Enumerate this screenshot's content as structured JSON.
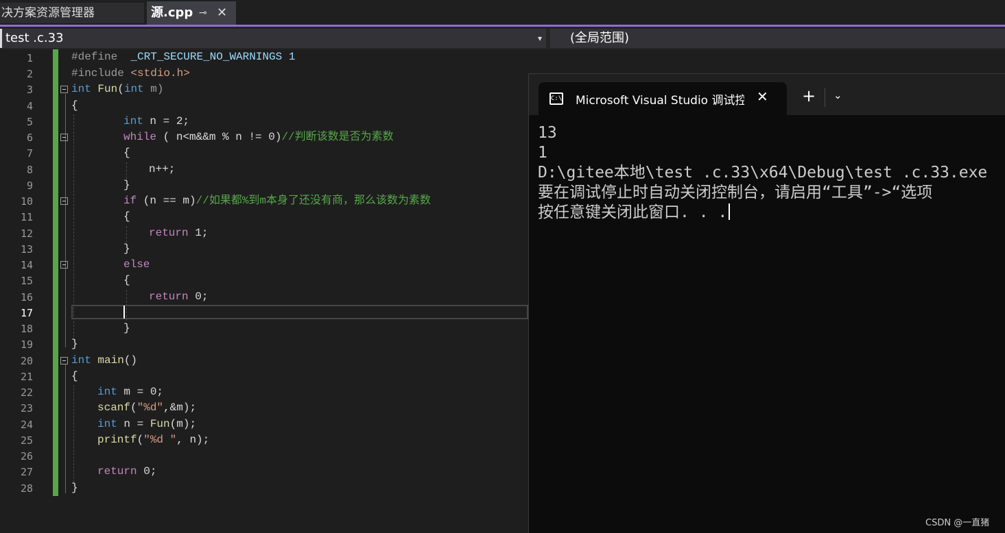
{
  "tabs": {
    "inactive_label": "决方案资源管理器",
    "active_label": "源.cpp",
    "pin_glyph": "⊸",
    "close_glyph": "✕"
  },
  "navbar": {
    "project": "test .c.33",
    "dropdown_arrow": "▾",
    "scope": "(全局范围)"
  },
  "editor": {
    "current_line": 17,
    "line_numbers": [
      "1",
      "2",
      "3",
      "4",
      "5",
      "6",
      "7",
      "8",
      "9",
      "10",
      "11",
      "12",
      "13",
      "14",
      "15",
      "16",
      "17",
      "18",
      "19",
      "20",
      "21",
      "22",
      "23",
      "24",
      "25",
      "26",
      "27",
      "28"
    ]
  },
  "console": {
    "icon_glyph": "C:\\",
    "title": "Microsoft Visual Studio 调试控制台",
    "close_glyph": "✕",
    "plus_glyph": "+",
    "chevron_glyph": "⌄",
    "output_lines": [
      "13",
      "1",
      "D:\\gitee本地\\test .c.33\\x64\\Debug\\test .c.33.exe",
      "要在调试停止时自动关闭控制台，请启用“工具”->“选项",
      "按任意键关闭此窗口. . ."
    ]
  },
  "watermark": "CSDN @一直猪",
  "colors": {
    "accent": "#8b6fd6",
    "keyword": "#c586c0",
    "type": "#569cd6",
    "comment": "#57a64a",
    "string": "#d69d85",
    "gutter_green": "#57a64a"
  },
  "code": {
    "l1_a": "#define  ",
    "l1_b": "_CRT_SECURE_NO_WARNINGS 1",
    "l2_a": "#include ",
    "l2_b": "<stdio.h>",
    "l3_a": "int",
    "l3_b": " ",
    "l3_c": "Fun",
    "l3_d": "(",
    "l3_e": "int",
    "l3_f": " m)",
    "l4": "{",
    "l5_a": "int",
    "l5_b": " n = 2;",
    "l6_a": "while",
    "l6_b": " ( n<m&&m % n != 0)",
    "l6_c": "//判断该数是否为素数",
    "l7": "{",
    "l8": "n++;",
    "l9": "}",
    "l10_a": "if",
    "l10_b": " (n == m)",
    "l10_c": "//如果都%到m本身了还没有商，那么该数为素数",
    "l11": "{",
    "l12_a": "return",
    "l12_b": " 1;",
    "l13": "}",
    "l14": "else",
    "l15": "{",
    "l16_a": "return",
    "l16_b": " 0;",
    "l18": "}",
    "l19": "}",
    "l20_a": "int",
    "l20_b": " ",
    "l20_c": "main",
    "l20_d": "()",
    "l21": "{",
    "l22_a": "int",
    "l22_b": " m = 0;",
    "l23_a": "scanf",
    "l23_b": "(",
    "l23_c": "\"%d\"",
    "l23_d": ",&m);",
    "l24_a": "int",
    "l24_b": " n = ",
    "l24_c": "Fun",
    "l24_d": "(m);",
    "l25_a": "printf",
    "l25_b": "(",
    "l25_c": "\"%d \"",
    "l25_d": ", n);",
    "l27_a": "return",
    "l27_b": " 0;",
    "l28": "}"
  }
}
